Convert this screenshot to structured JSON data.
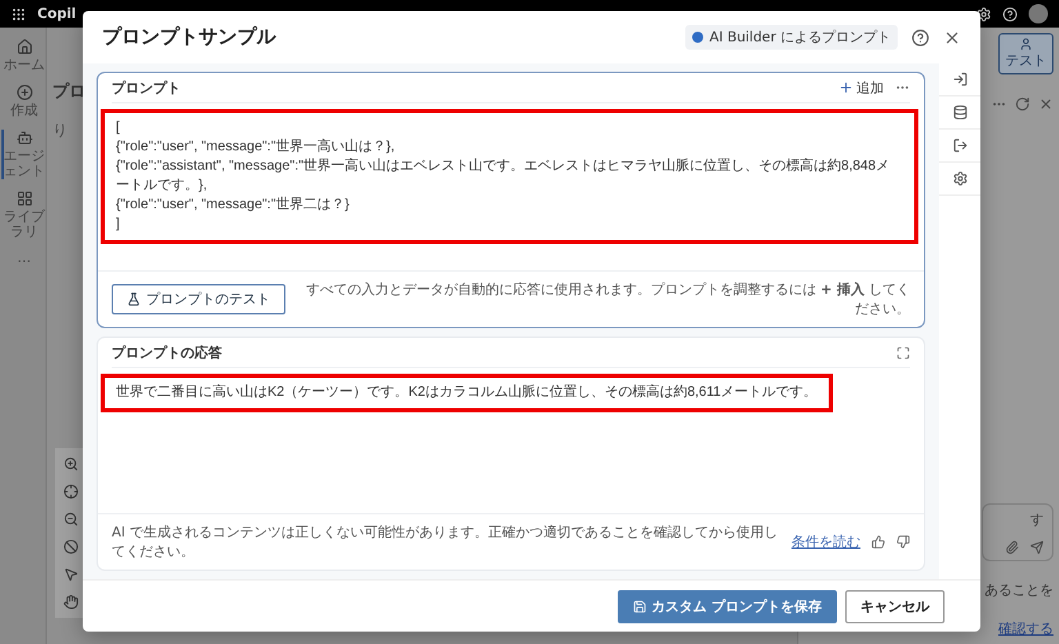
{
  "app": {
    "brand": "Copil",
    "nav": [
      {
        "label": "ホーム",
        "kind": "home",
        "selected": false
      },
      {
        "label": "作成",
        "kind": "create",
        "selected": false
      },
      {
        "label": "エージェント",
        "kind": "agent",
        "selected": true
      },
      {
        "label": "ライブラリ",
        "kind": "library",
        "selected": false
      },
      {
        "label": "…",
        "kind": "more",
        "selected": false
      }
    ],
    "page_heading": "プロ",
    "undo": "り",
    "test_button": "テスト",
    "chat_fragments": [
      "す",
      "あることを"
    ],
    "chat_link": "確認する"
  },
  "dialog": {
    "title": "プロンプトサンプル",
    "badge": "AI Builder によるプロンプト",
    "prompt": {
      "title": "プロンプト",
      "add": "追加",
      "highlighted": true,
      "lines": [
        "[",
        "{\"role\":\"user\", \"message\":\"世界一高い山は？},",
        "{\"role\":\"assistant\", \"message\":\"世界一高い山はエベレスト山です。エベレストはヒマラヤ山脈に位置し、その標高は約8,848メートルです。},",
        "{\"role\":\"user\", \"message\":\"世界二は？}",
        "]"
      ],
      "test_button": "プロンプトのテスト",
      "hint": "すべての入力とデータが自動的に応答に使用されます。プロンプトを調整するには **+ 挿入** してください。"
    },
    "response": {
      "title": "プロンプトの応答",
      "highlighted": true,
      "text": "世界で二番目に高い山はK2（ケーツー）です。K2はカラコルム山脈に位置し、その標高は約8,611メートルです。",
      "disclaimer": "AI で生成されるコンテンツは正しくない可能性があります。正確かつ適切であることを確認してから使用してください。",
      "link": "条件を読む"
    },
    "buttons": [
      {
        "label": "カスタム プロンプトを保存",
        "kind": "primary"
      },
      {
        "label": "キャンセル",
        "kind": "secondary"
      }
    ]
  }
}
